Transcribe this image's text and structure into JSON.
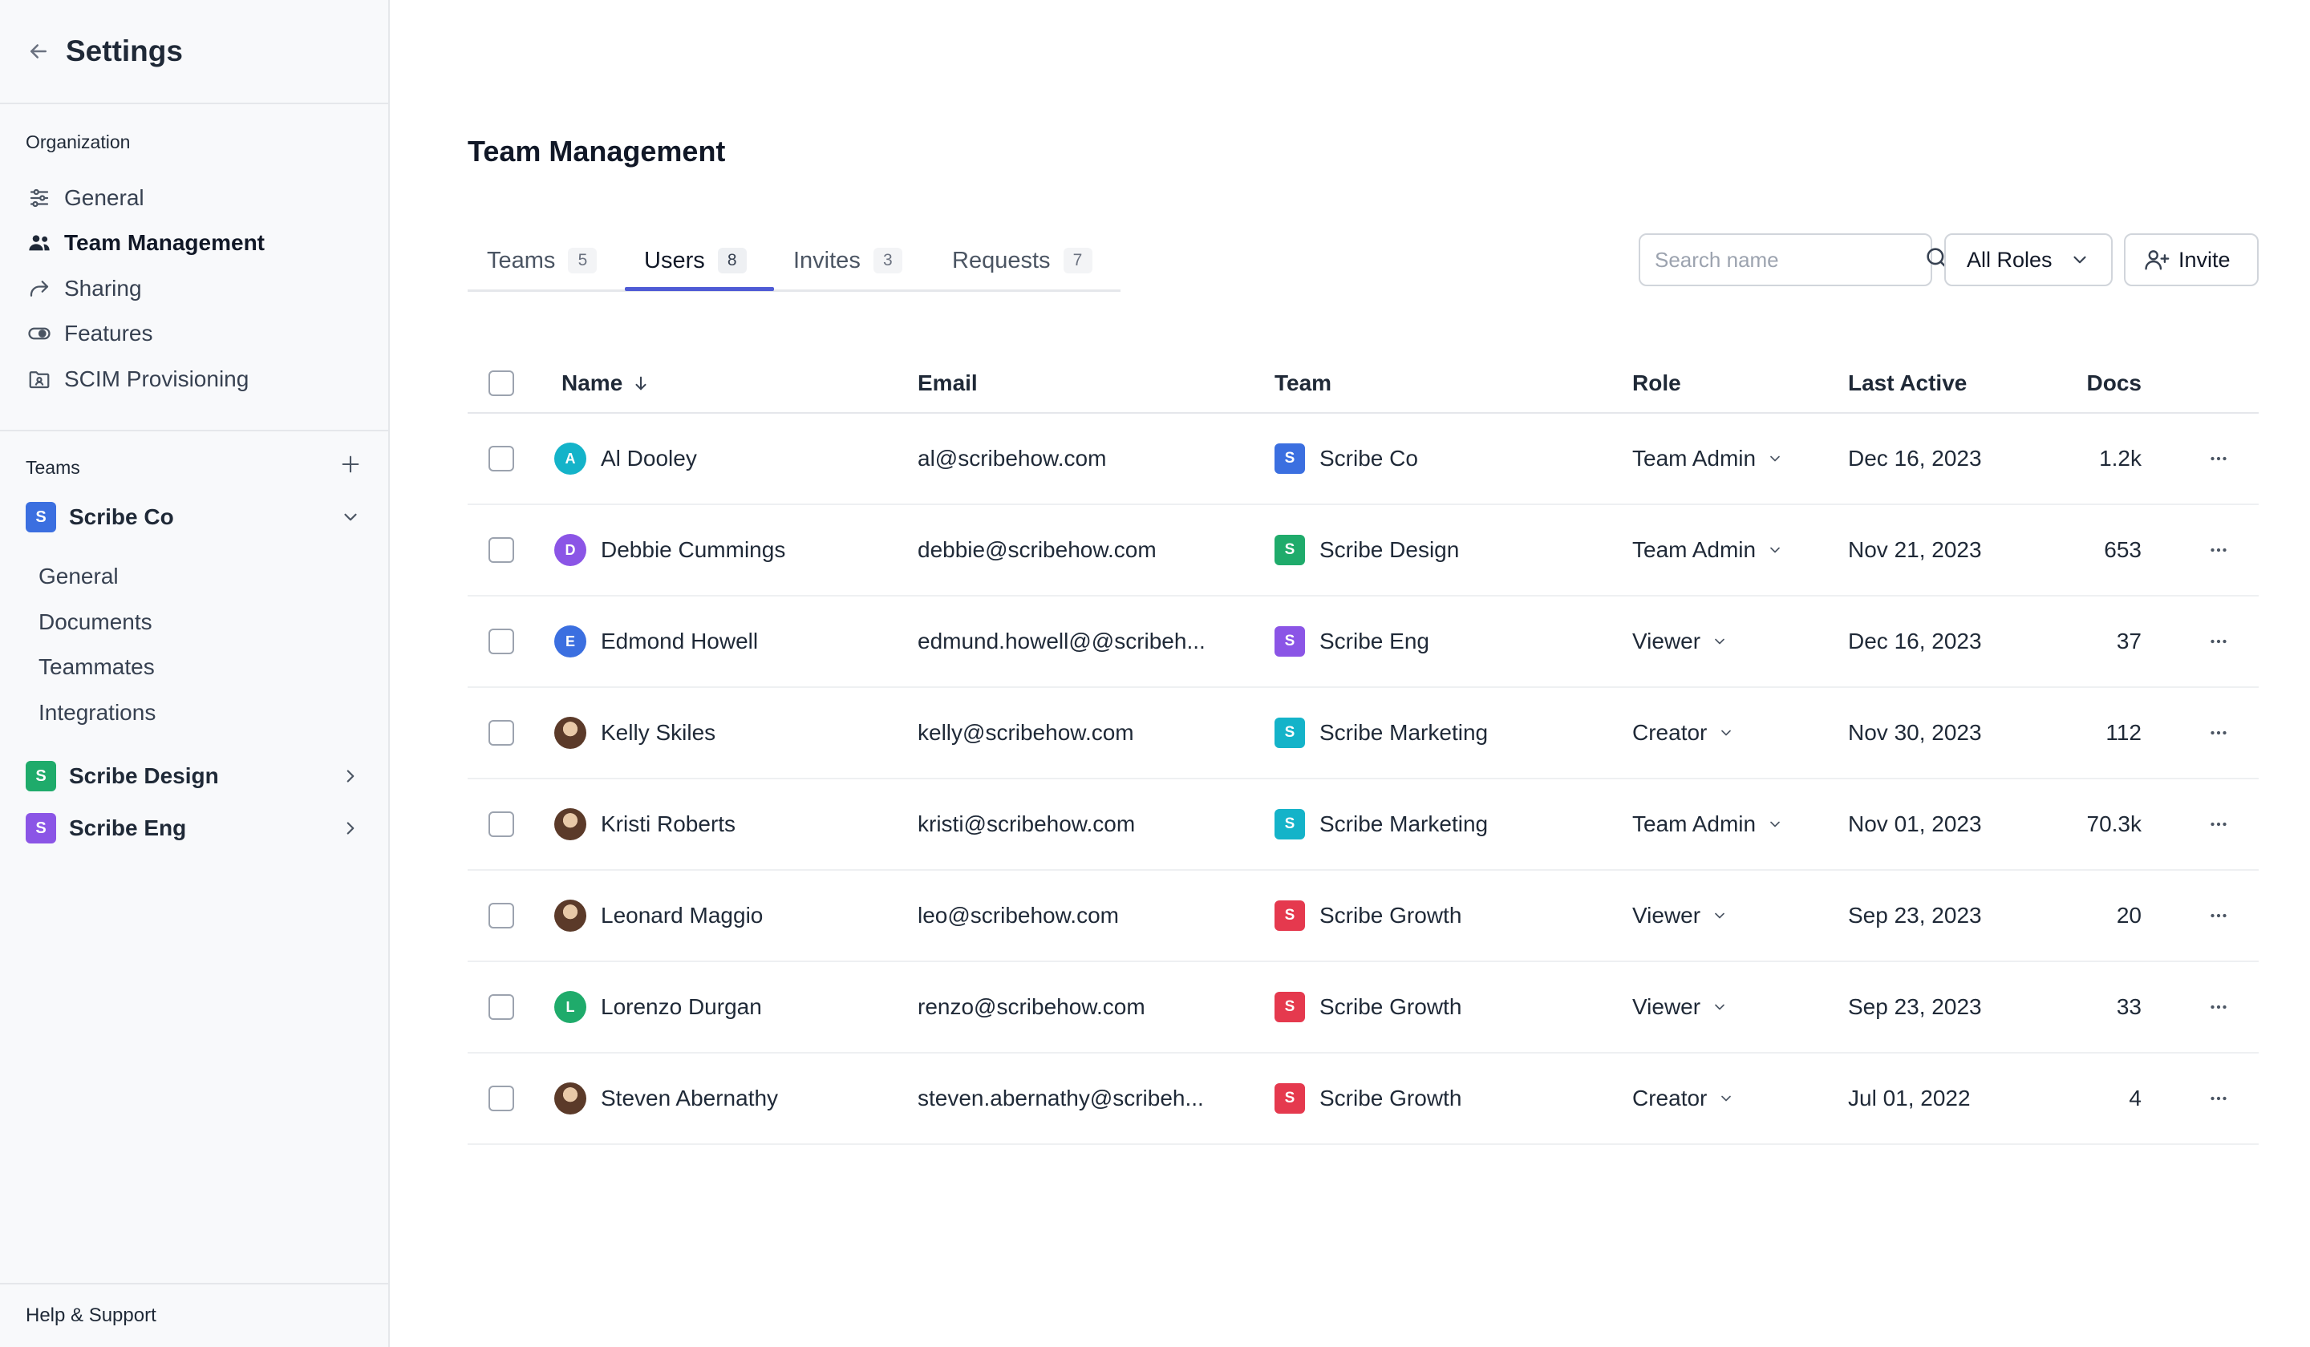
{
  "sidebar": {
    "title": "Settings",
    "org_label": "Organization",
    "org_items": [
      {
        "label": "General",
        "icon": "sliders-icon"
      },
      {
        "label": "Team Management",
        "icon": "users-icon",
        "active": true
      },
      {
        "label": "Sharing",
        "icon": "share-icon"
      },
      {
        "label": "Features",
        "icon": "toggle-icon"
      },
      {
        "label": "SCIM Provisioning",
        "icon": "folder-user-icon"
      }
    ],
    "teams_label": "Teams",
    "teams": [
      {
        "name": "Scribe Co",
        "badge": "S",
        "color": "#3b6fe0",
        "expanded": true,
        "sub_items": [
          "General",
          "Documents",
          "Teammates",
          "Integrations"
        ]
      },
      {
        "name": "Scribe Design",
        "badge": "S",
        "color": "#1fab6b",
        "expanded": false
      },
      {
        "name": "Scribe Eng",
        "badge": "S",
        "color": "#8b55e6",
        "expanded": false
      }
    ],
    "footer": "Help & Support"
  },
  "main": {
    "title": "Team Management",
    "tabs": [
      {
        "label": "Teams",
        "count": "5"
      },
      {
        "label": "Users",
        "count": "8",
        "active": true
      },
      {
        "label": "Invites",
        "count": "3"
      },
      {
        "label": "Requests",
        "count": "7"
      }
    ],
    "search_placeholder": "Search name",
    "roles_filter": "All Roles",
    "invite_label": "Invite"
  },
  "table": {
    "columns": {
      "name": "Name",
      "email": "Email",
      "team": "Team",
      "role": "Role",
      "last_active": "Last Active",
      "docs": "Docs"
    },
    "rows": [
      {
        "name": "Al Dooley",
        "initial": "A",
        "avatar_color": "#14b3c9",
        "email": "al@scribehow.com",
        "team": "Scribe Co",
        "team_color": "#3b6fe0",
        "role": "Team Admin",
        "last_active": "Dec 16, 2023",
        "docs": "1.2k"
      },
      {
        "name": "Debbie Cummings",
        "initial": "D",
        "avatar_color": "#8b55e6",
        "email": "debbie@scribehow.com",
        "team": "Scribe Design",
        "team_color": "#1fab6b",
        "role": "Team Admin",
        "last_active": "Nov 21, 2023",
        "docs": "653"
      },
      {
        "name": "Edmond Howell",
        "initial": "E",
        "avatar_color": "#3b6fe0",
        "email": "edmund.howell@@scribeh...",
        "team": "Scribe Eng",
        "team_color": "#8b55e6",
        "role": "Viewer",
        "last_active": "Dec 16, 2023",
        "docs": "37"
      },
      {
        "name": "Kelly Skiles",
        "initial": "",
        "avatar_color": "photo",
        "email": "kelly@scribehow.com",
        "team": "Scribe Marketing",
        "team_color": "#14b3c9",
        "role": "Creator",
        "last_active": "Nov 30, 2023",
        "docs": "112"
      },
      {
        "name": "Kristi Roberts",
        "initial": "",
        "avatar_color": "photo",
        "email": "kristi@scribehow.com",
        "team": "Scribe Marketing",
        "team_color": "#14b3c9",
        "role": "Team Admin",
        "last_active": "Nov 01, 2023",
        "docs": "70.3k"
      },
      {
        "name": "Leonard Maggio",
        "initial": "",
        "avatar_color": "photo",
        "email": "leo@scribehow.com",
        "team": "Scribe Growth",
        "team_color": "#e5394e",
        "role": "Viewer",
        "last_active": "Sep 23, 2023",
        "docs": "20"
      },
      {
        "name": "Lorenzo Durgan",
        "initial": "L",
        "avatar_color": "#1fab6b",
        "email": "renzo@scribehow.com",
        "team": "Scribe Growth",
        "team_color": "#e5394e",
        "role": "Viewer",
        "last_active": "Sep 23, 2023",
        "docs": "33"
      },
      {
        "name": "Steven Abernathy",
        "initial": "",
        "avatar_color": "photo",
        "email": "steven.abernathy@scribeh...",
        "team": "Scribe Growth",
        "team_color": "#e5394e",
        "role": "Creator",
        "last_active": "Jul 01, 2022",
        "docs": "4"
      }
    ]
  }
}
